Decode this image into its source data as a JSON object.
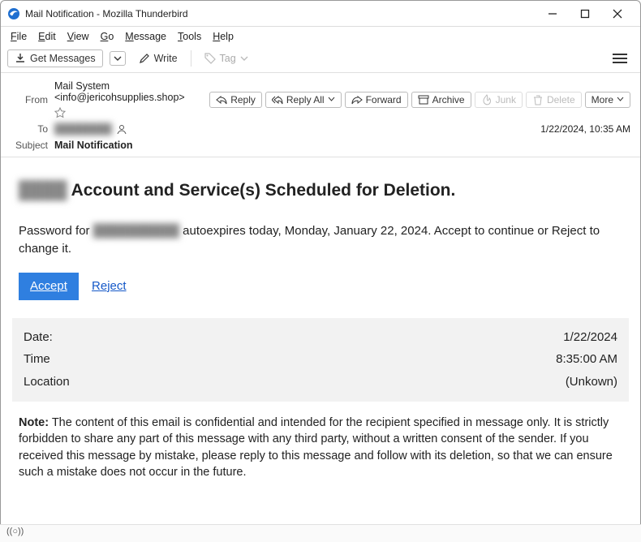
{
  "window": {
    "title": "Mail Notification - Mozilla Thunderbird"
  },
  "menubar": [
    "File",
    "Edit",
    "View",
    "Go",
    "Message",
    "Tools",
    "Help"
  ],
  "toolbar": {
    "getmsg": "Get Messages",
    "write": "Write",
    "tag": "Tag"
  },
  "headers": {
    "from_label": "From",
    "from_value": "Mail System <info@jericohsupplies.shop>",
    "to_label": "To",
    "to_redacted": "████████",
    "subject_label": "Subject",
    "subject_value": "Mail Notification",
    "date": "1/22/2024, 10:35 AM"
  },
  "actions": {
    "reply": "Reply",
    "replyall": "Reply All",
    "forward": "Forward",
    "archive": "Archive",
    "junk": "Junk",
    "delete": "Delete",
    "more": "More"
  },
  "email": {
    "title_redacted": "████",
    "title": " Account and Service(s) Scheduled for Deletion.",
    "p1a": "Password for ",
    "p1_redacted": "██████████",
    "p1b": " autoexpires today, Monday, January 22, 2024. Accept to continue or Reject to change it.",
    "accept": "Accept",
    "reject": "Reject",
    "info": [
      {
        "label": "Date:",
        "value": "1/22/2024"
      },
      {
        "label": "Time",
        "value": "8:35:00 AM"
      },
      {
        "label": "Location",
        "value": "(Unkown)"
      }
    ],
    "note_label": "Note:",
    "note": " The content of this email is confidential and intended for the recipient specified in message only. It is strictly forbidden to share any part of this message with any third party, without a written consent of the sender. If you received this message by mistake, please reply to this message and follow with its deletion, so that we can ensure such a mistake does not occur in the future."
  },
  "status": "((○))"
}
